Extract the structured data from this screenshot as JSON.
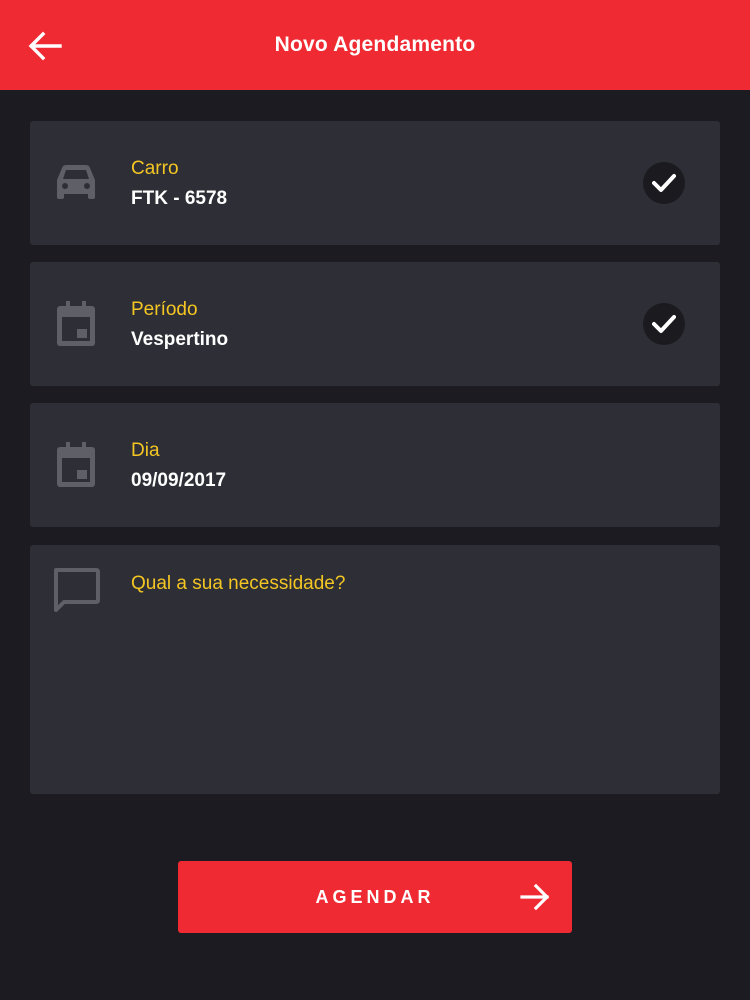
{
  "app_bar": {
    "title": "Novo Agendamento",
    "back_icon": "arrow-left-icon",
    "color": "#ef2a33"
  },
  "fields": [
    {
      "label": "Carro",
      "value": "FTK - 6578",
      "icon": "car-icon",
      "confirmed": true
    },
    {
      "label": "Período",
      "value": "Vespertino",
      "icon": "calendar-icon",
      "confirmed": true
    },
    {
      "label": "Dia",
      "value": "09/09/2017",
      "icon": "calendar-icon",
      "confirmed": false
    }
  ],
  "need": {
    "icon": "chat-bubble-icon",
    "placeholder": "Qual a sua necessidade?",
    "value": ""
  },
  "submit": {
    "label": "AGENDAR",
    "icon": "arrow-right-icon"
  },
  "colors": {
    "accent": "#ef2a33",
    "label": "#f3c623",
    "background": "#1b1b21",
    "card": "#2e2e36"
  }
}
